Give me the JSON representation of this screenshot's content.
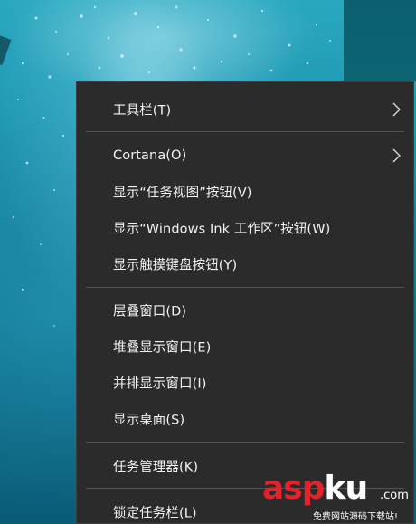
{
  "menu": {
    "items": [
      {
        "label": "工具栏(T)",
        "has_submenu": true
      },
      {
        "label": "Cortana(O)",
        "has_submenu": true
      },
      {
        "label": "显示“任务视图”按钮(V)",
        "has_submenu": false
      },
      {
        "label": "显示“Windows Ink 工作区”按钮(W)",
        "has_submenu": false
      },
      {
        "label": "显示触摸键盘按钮(Y)",
        "has_submenu": false
      },
      {
        "label": "层叠窗口(D)",
        "has_submenu": false
      },
      {
        "label": "堆叠显示窗口(E)",
        "has_submenu": false
      },
      {
        "label": "并排显示窗口(I)",
        "has_submenu": false
      },
      {
        "label": "显示桌面(S)",
        "has_submenu": false
      },
      {
        "label": "任务管理器(K)",
        "has_submenu": false
      },
      {
        "label": "锁定任务栏(L)",
        "has_submenu": false
      }
    ]
  },
  "watermark": {
    "brand_red": "asp",
    "brand_white": "ku",
    "suffix": ".com",
    "tagline": "免费网站源码下载站!"
  },
  "colors": {
    "menu_bg": "#2b2b2b",
    "menu_text": "#f2f2f2",
    "separator": "#545454",
    "brand_red": "#e3232b"
  }
}
